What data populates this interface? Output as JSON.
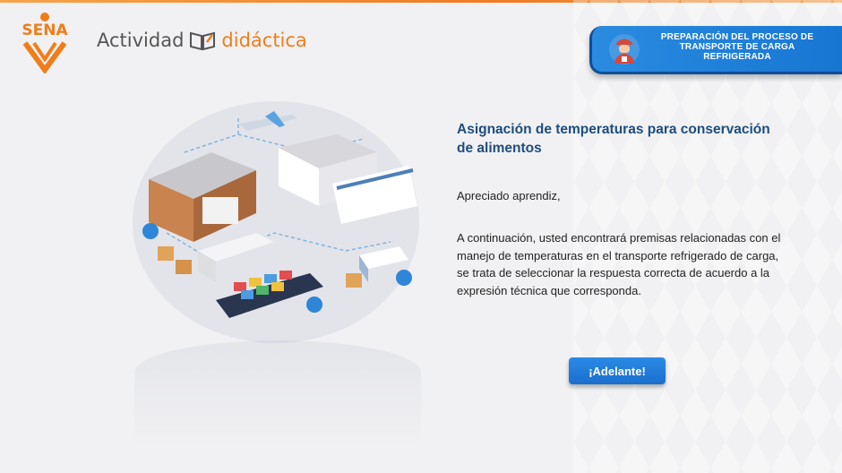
{
  "brand": {
    "logo_text": "SENA",
    "activity_word": "Actividad",
    "didactic_word": "didáctica"
  },
  "header": {
    "title_line1": "PREPARACIÓN DEL PROCESO DE",
    "title_line2": "TRANSPORTE DE CARGA",
    "title_line3": "REFRIGERADA"
  },
  "content": {
    "title": "Asignación de temperaturas para conservación de alimentos",
    "greeting": "Apreciado aprendiz,",
    "body": "A continuación, usted encontrará premisas relacionadas con el manejo de temperaturas en el transporte refrigerado de carga, se trata de seleccionar la respuesta correcta de acuerdo a la expresión técnica que corresponda."
  },
  "actions": {
    "next_label": "¡Adelante!"
  },
  "colors": {
    "brand_orange": "#f07d1a",
    "title_blue": "#1d4d7e",
    "button_blue": "#1a6fcd",
    "background": "#f1f1f3"
  },
  "icons": {
    "logo": "sena-logo",
    "book": "open-book-icon",
    "avatar": "worker-avatar-icon",
    "illustration": "logistics-illustration"
  }
}
